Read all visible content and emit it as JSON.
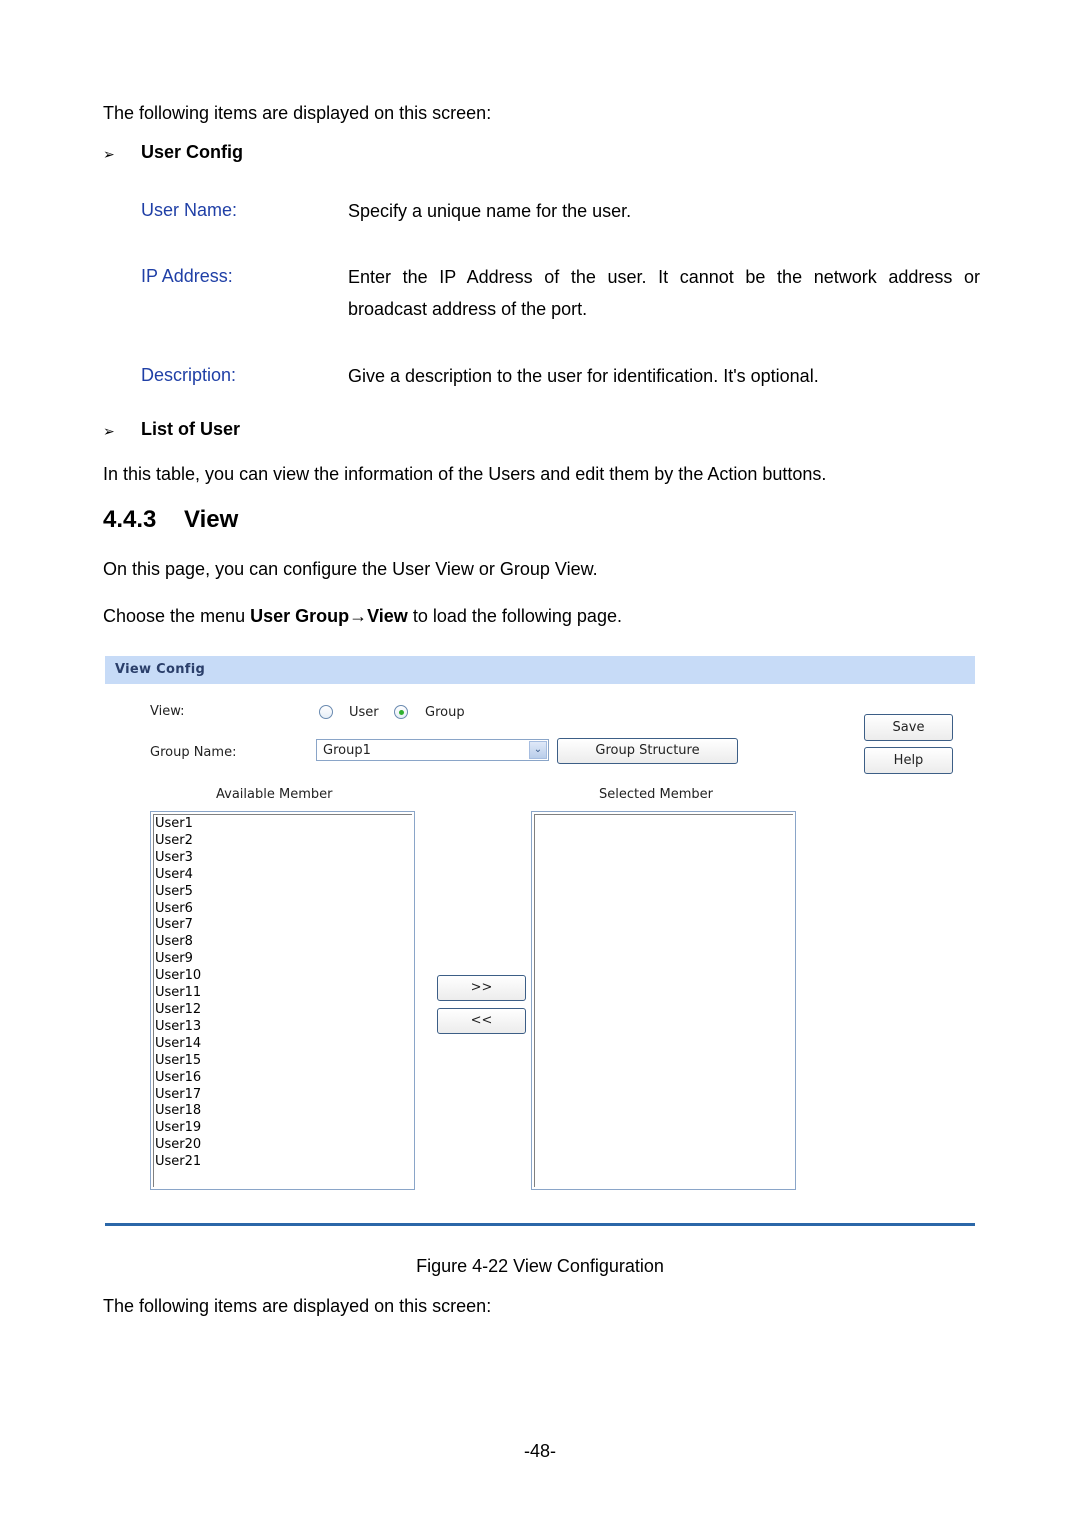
{
  "intro": "The following items are displayed on this screen:",
  "user_config": {
    "bullet": "➢",
    "title": "User Config",
    "items": [
      {
        "term": "User Name:",
        "desc": "Specify a unique name for the user."
      },
      {
        "term": "IP Address:",
        "desc_line1": "Enter the IP Address of the user. It cannot be the network address or",
        "desc_line2": "broadcast address of the port."
      },
      {
        "term": "Description:",
        "desc": "Give a description to the user for identification. It's optional."
      }
    ]
  },
  "list_of_user": {
    "bullet": "➢",
    "title": "List of User",
    "desc": "In this table, you can view the information of the Users and edit them by the Action buttons."
  },
  "section": {
    "number": "4.4.3",
    "title": "View",
    "desc": "On this page, you can configure the User View or Group View.",
    "menu_prefix": "Choose the menu ",
    "menu_path": "User Group→View",
    "menu_suffix": " to load the following page."
  },
  "figure": {
    "panel_title": "View Config",
    "view_label": "View:",
    "view_options": [
      {
        "label": "User",
        "checked": false
      },
      {
        "label": "Group",
        "checked": true
      }
    ],
    "group_name_label": "Group Name:",
    "group_name_value": "Group1",
    "group_structure_button": "Group Structure",
    "save_button": "Save",
    "help_button": "Help",
    "available_title": "Available Member",
    "selected_title": "Selected Member",
    "available_members": [
      "User1",
      "User2",
      "User3",
      "User4",
      "User5",
      "User6",
      "User7",
      "User8",
      "User9",
      "User10",
      "User11",
      "User12",
      "User13",
      "User14",
      "User15",
      "User16",
      "User17",
      "User18",
      "User19",
      "User20",
      "User21"
    ],
    "selected_members": [],
    "add_button": ">>",
    "remove_button": "<<",
    "caption": "Figure 4-22 View Configuration"
  },
  "outro": "The following items are displayed on this screen:",
  "page_number": "-48-"
}
